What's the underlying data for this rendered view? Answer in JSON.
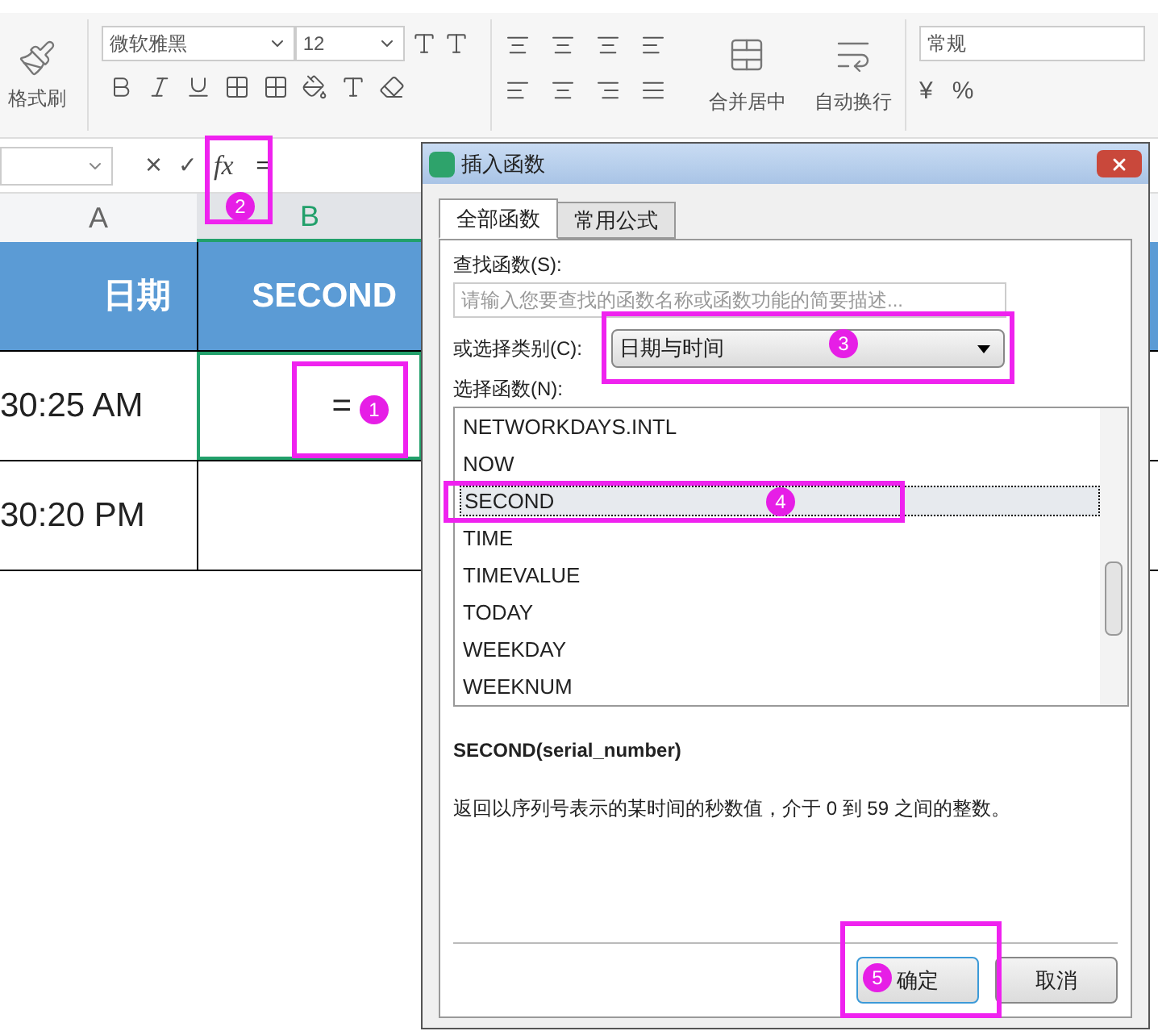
{
  "ribbon": {
    "format_painter": "格式刷",
    "font_name": "微软雅黑",
    "font_size": "12",
    "merge_button": "合并居中",
    "wrap_button": "自动换行",
    "number_format": "常规",
    "currency": "¥",
    "percent": "%"
  },
  "formula_bar": {
    "cancel": "×",
    "confirm": "✓",
    "fx": "fx",
    "formula": "="
  },
  "sheet": {
    "columns": [
      {
        "label": "A",
        "selected": false
      },
      {
        "label": "B",
        "selected": true
      }
    ],
    "rows": [
      {
        "kind": "header",
        "cells": [
          {
            "text": "日期",
            "selected": false
          },
          {
            "text": "SECOND",
            "selected": false
          }
        ]
      },
      {
        "kind": "data",
        "cells": [
          {
            "text": "30:25 AM",
            "selected": false
          },
          {
            "text": "=",
            "selected": true
          }
        ]
      },
      {
        "kind": "data",
        "cells": [
          {
            "text": "30:20 PM",
            "selected": false
          },
          {
            "selected": false
          }
        ]
      }
    ]
  },
  "dialog": {
    "title": "插入函数",
    "tabs": [
      {
        "label": "全部函数",
        "selected": true
      },
      {
        "label": "常用公式",
        "selected": false
      }
    ],
    "search_label": "查找函数(S):",
    "search_placeholder": "请输入您要查找的函数名称或函数功能的简要描述...",
    "category_label": "或选择类别(C):",
    "category": "日期与时间",
    "list_label": "选择函数(N):",
    "functions": [
      {
        "name": "NETWORKDAYS.INTL",
        "selected": false
      },
      {
        "name": "NOW",
        "selected": false
      },
      {
        "name": "SECOND",
        "selected": true
      },
      {
        "name": "TIME",
        "selected": false
      },
      {
        "name": "TIMEVALUE",
        "selected": false
      },
      {
        "name": "TODAY",
        "selected": false
      },
      {
        "name": "WEEKDAY",
        "selected": false
      },
      {
        "name": "WEEKNUM",
        "selected": false
      }
    ],
    "signature": "SECOND(serial_number)",
    "description": "返回以序列号表示的某时间的秒数值，介于 0 到 59 之间的整数。",
    "buttons": [
      {
        "label": "确定",
        "kind": "primary"
      },
      {
        "label": "取消",
        "kind": "default"
      }
    ]
  },
  "annotations": [
    "1",
    "2",
    "3",
    "4",
    "5"
  ]
}
